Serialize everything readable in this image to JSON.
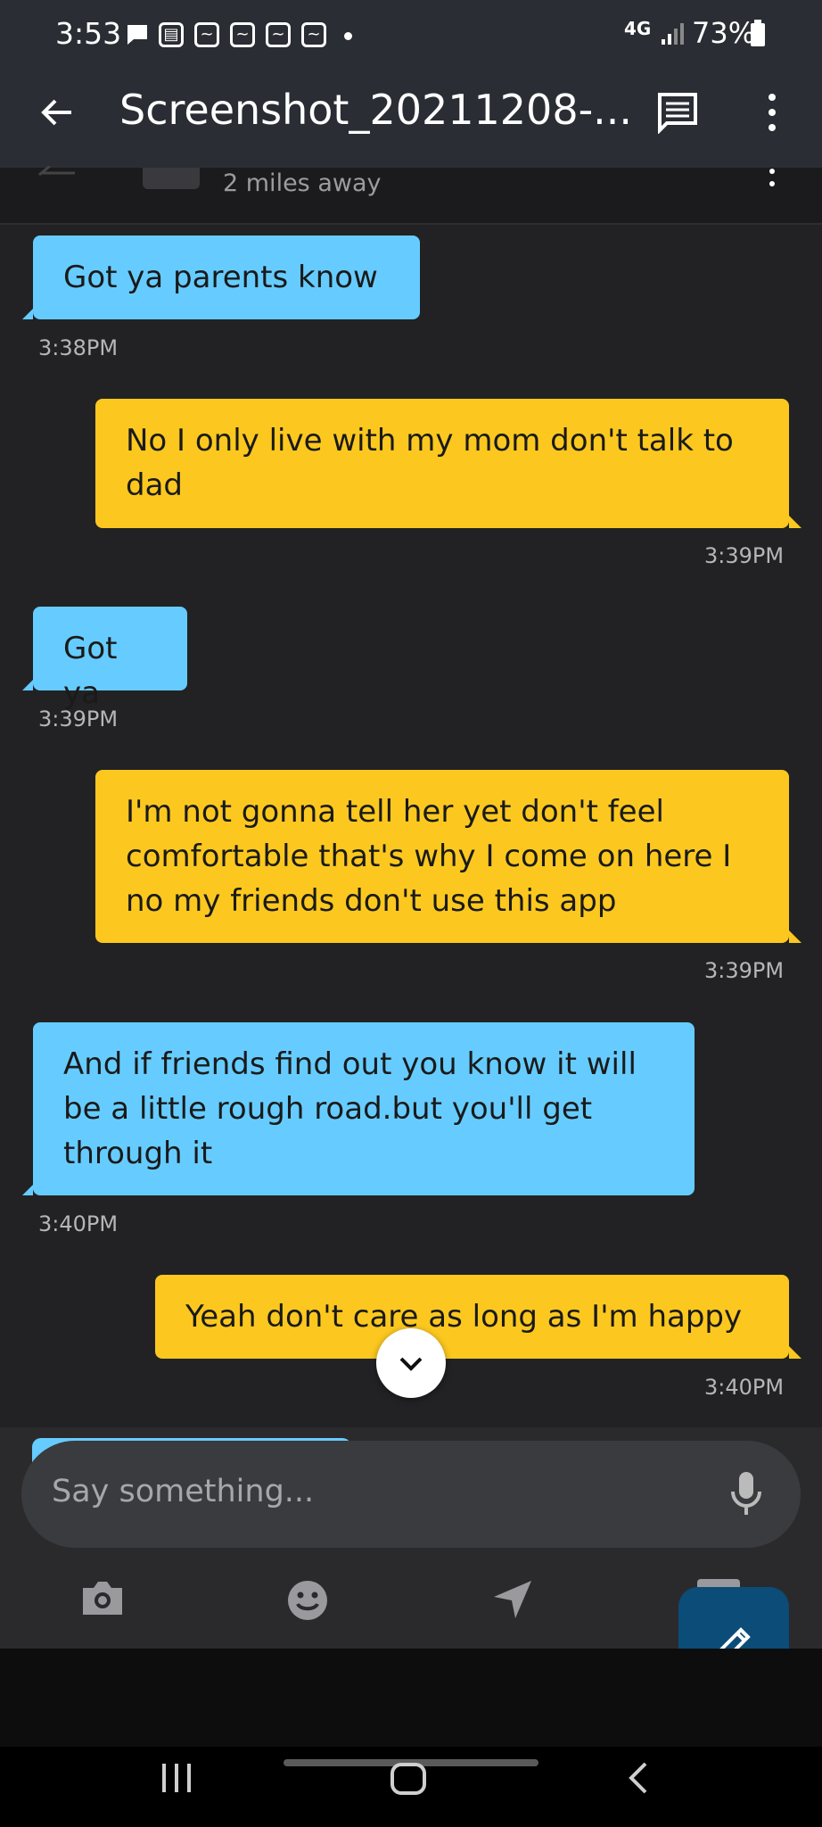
{
  "status": {
    "time": "3:53",
    "network": "4G",
    "battery": "73%"
  },
  "header": {
    "title": "Screenshot_20211208-..."
  },
  "profile": {
    "distance": "2 miles away"
  },
  "messages": [
    {
      "dir": "in",
      "text": "Got ya parents know",
      "time": "3:38PM"
    },
    {
      "dir": "out",
      "text": "No I only live with my mom don't talk to dad",
      "time": "3:39PM"
    },
    {
      "dir": "in",
      "text": "Got ya",
      "time": "3:39PM"
    },
    {
      "dir": "out",
      "text": "I'm not gonna tell her yet don't feel comfortable that's why I come on here I no my friends don't use this app",
      "time": "3:39PM"
    },
    {
      "dir": "in",
      "text": "And if friends find out you know it will be a little rough road.but you'll get through it",
      "time": "3:40PM"
    },
    {
      "dir": "out",
      "text": "Yeah don't care as long as I'm happy",
      "time": "3:40PM"
    }
  ],
  "composer": {
    "placeholder": "Say something..."
  },
  "colors": {
    "incoming": "#66ccff",
    "outgoing": "#fcc81f",
    "fab": "#0b4c78"
  },
  "icons": [
    "back-arrow-icon",
    "message-icon",
    "overflow-menu-icon",
    "chevron-down-icon",
    "microphone-icon",
    "camera-icon",
    "smiley-icon",
    "location-arrow-icon",
    "pencil-icon",
    "recent-apps-icon",
    "home-icon",
    "back-icon"
  ]
}
